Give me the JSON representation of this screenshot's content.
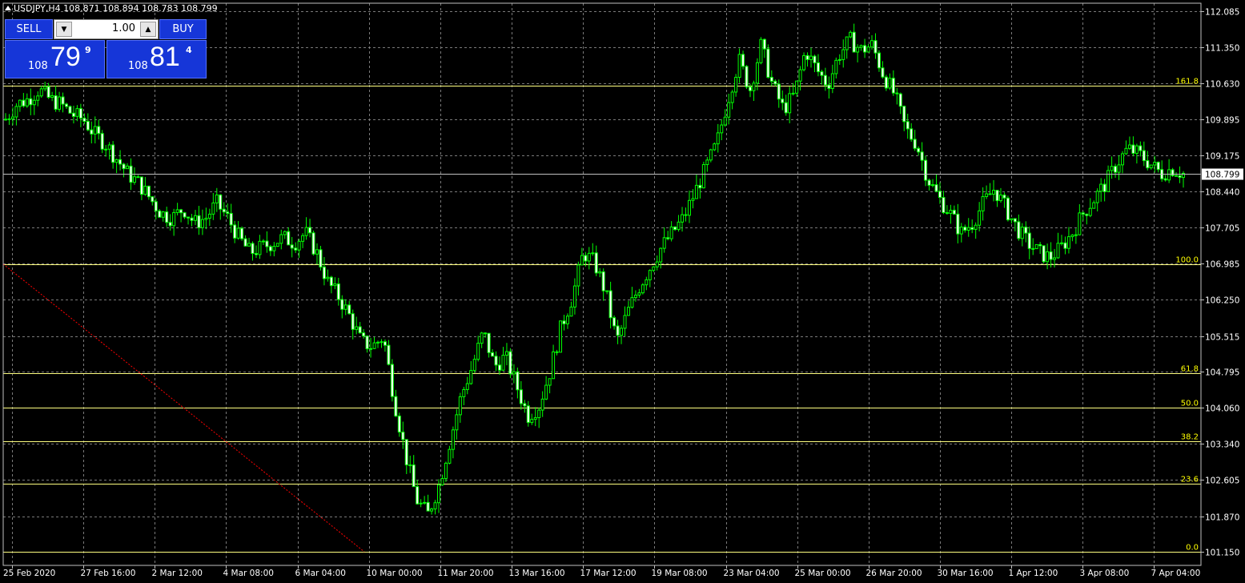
{
  "window": {
    "title": "USDJPY,H4  108.871 108.894 108.783 108.799"
  },
  "trade_panel": {
    "sell_label": "SELL",
    "buy_label": "BUY",
    "lot_value": "1.00",
    "sell_price_prefix": "108",
    "sell_price_big": "79",
    "sell_price_sup": "9",
    "buy_price_prefix": "108",
    "buy_price_big": "81",
    "buy_price_sup": "4"
  },
  "colors": {
    "background": "#000000",
    "grid": "#7a7a7a",
    "bull_candle": "#00ff00",
    "bear_candle_body": "#ffffff",
    "fib_line": "#ffff80",
    "fib_label": "#ffff00",
    "trend_line": "#ff0000",
    "panel_blue": "#1636d8"
  },
  "chart_data": {
    "type": "candlestick",
    "symbol": "USDJPY",
    "timeframe": "H4",
    "last_price": "108.799",
    "ylim": [
      100.9,
      112.3
    ],
    "grid": true,
    "y_ticks": [
      "112.085",
      "111.350",
      "110.630",
      "109.895",
      "109.175",
      "108.440",
      "107.705",
      "106.985",
      "106.250",
      "105.515",
      "104.795",
      "104.060",
      "103.340",
      "102.605",
      "101.870",
      "101.150"
    ],
    "x_ticks": [
      "25 Feb 2020",
      "27 Feb 16:00",
      "2 Mar 12:00",
      "4 Mar 08:00",
      "6 Mar 04:00",
      "10 Mar 00:00",
      "11 Mar 20:00",
      "13 Mar 16:00",
      "17 Mar 12:00",
      "19 Mar 08:00",
      "23 Mar 04:00",
      "25 Mar 00:00",
      "26 Mar 20:00",
      "30 Mar 16:00",
      "1 Apr 12:00",
      "3 Apr 08:00",
      "7 Apr 04:00"
    ],
    "fibonacci": [
      {
        "label": "161.8",
        "price": 110.58
      },
      {
        "label": "100.0",
        "price": 106.97
      },
      {
        "label": "61.8",
        "price": 104.76
      },
      {
        "label": "50.0",
        "price": 104.07
      },
      {
        "label": "38.2",
        "price": 103.38
      },
      {
        "label": "23.6",
        "price": 102.53
      },
      {
        "label": "0.0",
        "price": 101.15
      }
    ],
    "trend_line": {
      "from_price": 106.97,
      "to_price": 101.15
    },
    "close_path": [
      109.9,
      110.2,
      110.3,
      110.5,
      110.3,
      110.2,
      110.0,
      109.9,
      109.6,
      109.4,
      109.1,
      108.8,
      108.6,
      108.3,
      108.0,
      107.9,
      108.1,
      107.8,
      107.9,
      108.2,
      107.9,
      107.5,
      107.2,
      107.3,
      107.4,
      107.5,
      107.4,
      107.6,
      107.2,
      106.6,
      106.3,
      105.9,
      105.4,
      105.3,
      105.5,
      104.2,
      103.1,
      102.2,
      101.9,
      102.5,
      103.4,
      104.3,
      104.9,
      105.6,
      104.9,
      105.1,
      104.5,
      103.9,
      104.1,
      104.8,
      105.7,
      106.3,
      107.2,
      107.0,
      106.4,
      105.4,
      106.0,
      106.5,
      106.9,
      107.3,
      107.6,
      107.9,
      108.4,
      108.9,
      109.4,
      110.3,
      111.1,
      110.5,
      111.4,
      110.6,
      110.1,
      110.4,
      111.3,
      110.9,
      110.6,
      111.2,
      111.5,
      111.3,
      111.4,
      110.8,
      110.4,
      109.7,
      109.4,
      108.7,
      108.3,
      108.0,
      107.6,
      107.8,
      108.2,
      108.5,
      108.1,
      107.7,
      107.4,
      107.2,
      107.1,
      107.3,
      107.6,
      108.0,
      108.3,
      108.6,
      109.0,
      109.3,
      109.2,
      109.0,
      108.8,
      108.9,
      108.8
    ]
  }
}
